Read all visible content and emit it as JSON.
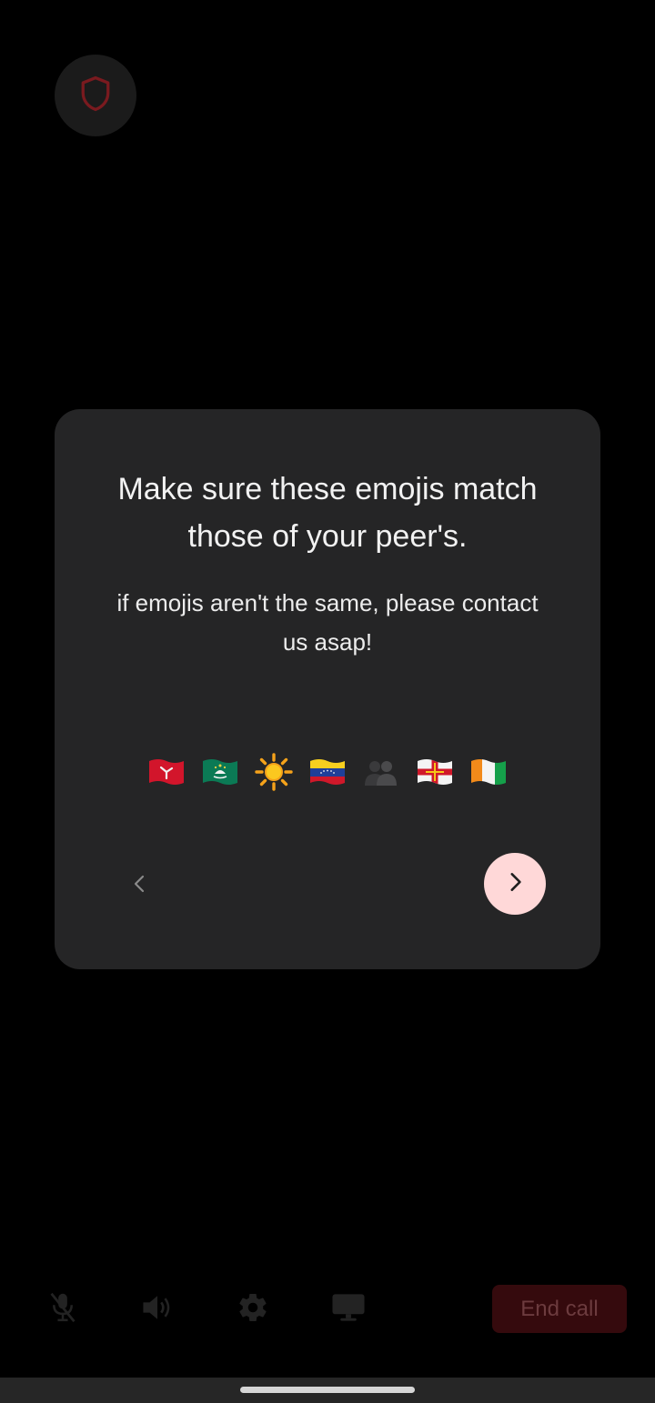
{
  "security_button": {
    "icon": "shield-icon",
    "color": "#7a1a1f"
  },
  "verification_dialog": {
    "title": "Make sure these emojis match those of your peer's.",
    "subtitle": "if emojis aren't the same, please contact us asap!",
    "emojis": [
      {
        "name": "Isle of Man flag",
        "icon": "isle-of-man-flag-icon"
      },
      {
        "name": "Macao flag",
        "icon": "macao-flag-icon"
      },
      {
        "name": "sun",
        "icon": "sun-icon"
      },
      {
        "name": "Venezuela flag",
        "icon": "venezuela-flag-icon"
      },
      {
        "name": "busts in silhouette",
        "icon": "busts-in-silhouette-icon"
      },
      {
        "name": "Guernsey flag",
        "icon": "guernsey-flag-icon"
      },
      {
        "name": "Côte d'Ivoire flag",
        "icon": "ivory-coast-flag-icon"
      }
    ],
    "prev_icon": "chevron-left-icon",
    "next_icon": "chevron-right-icon",
    "next_button_color": "#ffd8d8"
  },
  "call_controls": {
    "mute_icon": "microphone-off-icon",
    "speaker_icon": "speaker-icon",
    "settings_icon": "gear-icon",
    "screen_share_icon": "monitor-icon",
    "end_call_label": "End call",
    "end_call_color": "#350a0d"
  }
}
